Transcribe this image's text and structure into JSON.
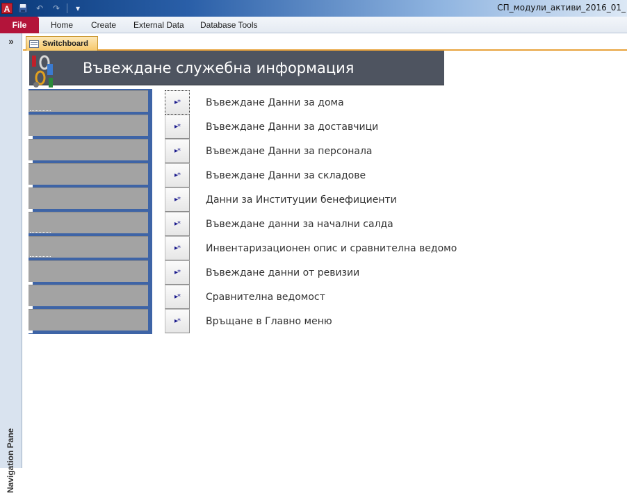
{
  "window": {
    "title": "СП_модули_активи_2016_01_",
    "app_icon": "A"
  },
  "quick_access": {
    "save_icon": "floppy-disk-icon",
    "undo_icon": "undo-icon",
    "redo_icon": "redo-icon",
    "customize_icon": "chevron-down-icon"
  },
  "ribbon": {
    "file_label": "File",
    "tabs": [
      "Home",
      "Create",
      "External Data",
      "Database Tools"
    ]
  },
  "nav_pane": {
    "label": "Navigation Pane",
    "expand_glyph": "»"
  },
  "document_tab": {
    "label": "Switchboard"
  },
  "switchboard": {
    "title": "Въвеждане служебна информация",
    "button_glyph": "▸*",
    "items": [
      "Въвеждане Данни за дома",
      "Въвеждане Данни за доставчици",
      "Въвеждане Данни за персонала",
      "Въвеждане Данни за складове",
      "Данни за Институции бенефициенти",
      "Въвеждане данни за начални салда",
      "Инвентаризационен опис и сравнителна ведомо",
      "Въвеждане данни от ревизии",
      "Сравнителна ведомост",
      "Връщане в Главно меню"
    ]
  },
  "colors": {
    "header_bg": "#4e5460",
    "left_panel_blue": "#3e64a6",
    "left_panel_gray": "#a3a3a3",
    "file_tab": "#b3143a",
    "doc_tab_accent": "#e8a23a"
  }
}
